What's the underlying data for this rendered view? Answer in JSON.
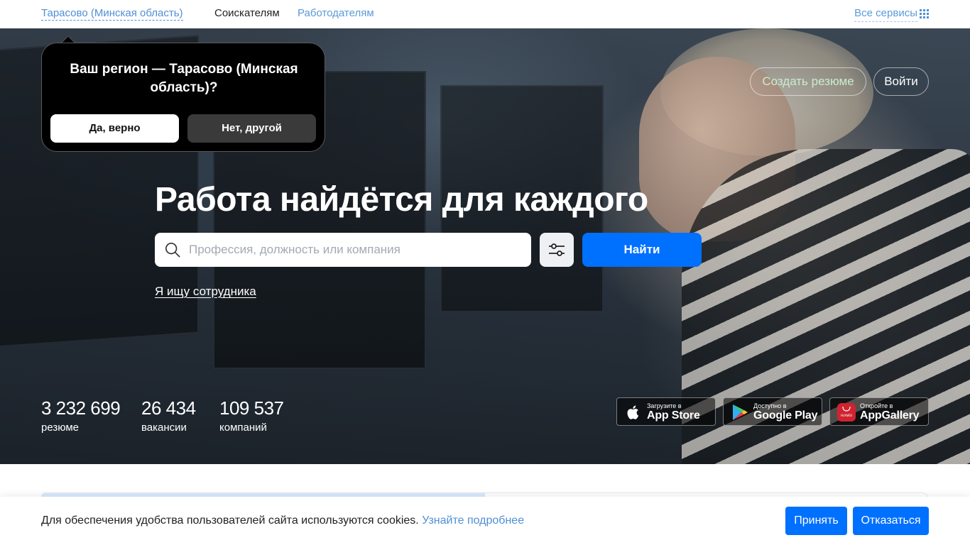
{
  "header": {
    "region": "Тарасово (Минская область)",
    "nav_seekers": "Соискателям",
    "nav_employers": "Работодателям",
    "all_services": "Все сервисы"
  },
  "region_popup": {
    "question": "Ваш регион — Тарасово (Минская область)?",
    "yes_label": "Да, верно",
    "no_label": "Нет, другой"
  },
  "hero": {
    "create_resume": "Создать резюме",
    "login": "Войти",
    "title": "Работа найдётся для каждого",
    "search_placeholder": "Профессия, должность или компания",
    "search_value": "",
    "find_button": "Найти",
    "employer_link": "Я ищу сотрудника"
  },
  "stats": [
    {
      "value": "3 232 699",
      "label": "резюме"
    },
    {
      "value": "26 434",
      "label": "вакансии"
    },
    {
      "value": "109 537",
      "label": "компаний"
    }
  ],
  "stores": [
    {
      "small": "Загрузите в",
      "big": "App Store",
      "icon": "apple-icon"
    },
    {
      "small": "Доступно в",
      "big": "Google Play",
      "icon": "google-play-icon"
    },
    {
      "small": "Откройте в",
      "big": "AppGallery",
      "icon": "huawei-icon",
      "brand_text": "HUAWEI"
    }
  ],
  "cookie": {
    "text": "Для обеспечения удобства пользователей сайта используются cookies.",
    "more": "Узнайте подробнее",
    "accept": "Принять",
    "decline": "Отказаться"
  },
  "colors": {
    "accent": "#0070ff",
    "link": "#4f8fd6",
    "popup_bg": "#000000"
  }
}
